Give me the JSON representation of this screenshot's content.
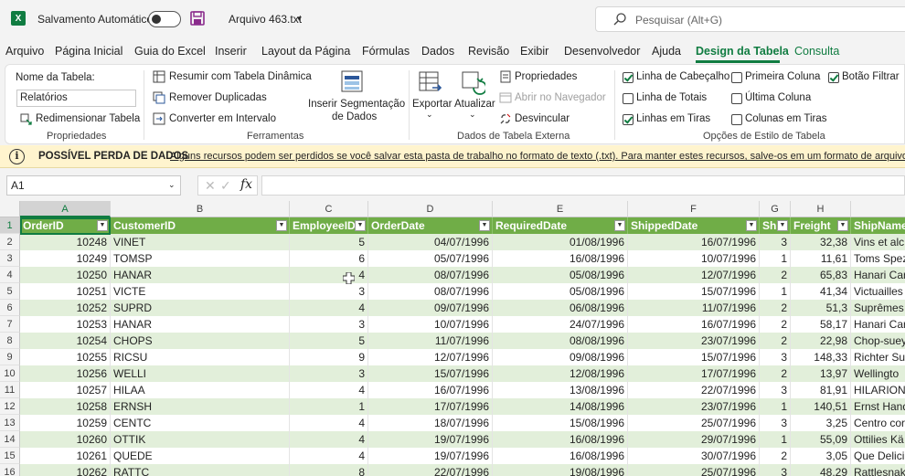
{
  "titlebar": {
    "autosave_label": "Salvamento Automático",
    "file_name": "Arquivo 463.txt",
    "search_placeholder": "Pesquisar (Alt+G)"
  },
  "menu": [
    "Arquivo",
    "Página Inicial",
    "Guia do Excel",
    "Inserir",
    "Layout da Página",
    "Fórmulas",
    "Dados",
    "Revisão",
    "Exibir",
    "Desenvolvedor",
    "Ajuda",
    "Design da Tabela",
    "Consulta"
  ],
  "ribbon": {
    "propriedades": {
      "label": "Propriedades",
      "table_name_label": "Nome da Tabela:",
      "table_name_value": "Relatórios",
      "resize": "Redimensionar Tabela"
    },
    "ferramentas": {
      "label": "Ferramentas",
      "pivot": "Resumir com Tabela Dinâmica",
      "dupes": "Remover Duplicadas",
      "convert": "Converter em Intervalo",
      "slicer_line1": "Inserir Segmentação",
      "slicer_line2": "de Dados"
    },
    "externa": {
      "label": "Dados de Tabela Externa",
      "export": "Exportar",
      "refresh": "Atualizar",
      "props": "Propriedades",
      "open_browser": "Abrir no Navegador",
      "unlink": "Desvincular"
    },
    "estilo": {
      "label": "Opções de Estilo de Tabela",
      "header_row": "Linha de Cabeçalho",
      "total_row": "Linha de Totais",
      "banded_rows": "Linhas em Tiras",
      "first_col": "Primeira Coluna",
      "last_col": "Última Coluna",
      "banded_cols": "Colunas em Tiras",
      "filter_btn": "Botão Filtrar"
    }
  },
  "infobar": {
    "title": "POSSÍVEL PERDA DE DADOS",
    "message": "Alguns recursos podem ser perdidos se você salvar esta pasta de trabalho no formato de texto (.txt). Para manter estes recursos, salve-os em um formato de arquivo do Excel"
  },
  "formula": {
    "name_box": "A1",
    "fx": "fx"
  },
  "grid": {
    "columns": [
      "A",
      "B",
      "C",
      "D",
      "E",
      "F",
      "G",
      "H"
    ],
    "headers": [
      "OrderID",
      "CustomerID",
      "EmployeeID",
      "OrderDate",
      "RequiredDate",
      "ShippedDate",
      "Sh",
      "Freight",
      "ShipName"
    ],
    "row_numbers": [
      "1",
      "2",
      "3",
      "4",
      "5",
      "6",
      "7",
      "8",
      "9",
      "10",
      "11",
      "12",
      "13",
      "14",
      "15",
      "16"
    ],
    "rows": [
      [
        "10248",
        "VINET",
        "5",
        "04/07/1996",
        "01/08/1996",
        "16/07/1996",
        "3",
        "32,38",
        "Vins et alc"
      ],
      [
        "10249",
        "TOMSP",
        "6",
        "05/07/1996",
        "16/08/1996",
        "10/07/1996",
        "1",
        "11,61",
        "Toms Spez"
      ],
      [
        "10250",
        "HANAR",
        "4",
        "08/07/1996",
        "05/08/1996",
        "12/07/1996",
        "2",
        "65,83",
        "Hanari Car"
      ],
      [
        "10251",
        "VICTE",
        "3",
        "08/07/1996",
        "05/08/1996",
        "15/07/1996",
        "1",
        "41,34",
        "Victuailles"
      ],
      [
        "10252",
        "SUPRD",
        "4",
        "09/07/1996",
        "06/08/1996",
        "11/07/1996",
        "2",
        "51,3",
        "Suprêmes"
      ],
      [
        "10253",
        "HANAR",
        "3",
        "10/07/1996",
        "24/07/1996",
        "16/07/1996",
        "2",
        "58,17",
        "Hanari Car"
      ],
      [
        "10254",
        "CHOPS",
        "5",
        "11/07/1996",
        "08/08/1996",
        "23/07/1996",
        "2",
        "22,98",
        "Chop-suey"
      ],
      [
        "10255",
        "RICSU",
        "9",
        "12/07/1996",
        "09/08/1996",
        "15/07/1996",
        "3",
        "148,33",
        "Richter Su"
      ],
      [
        "10256",
        "WELLI",
        "3",
        "15/07/1996",
        "12/08/1996",
        "17/07/1996",
        "2",
        "13,97",
        "Wellingto"
      ],
      [
        "10257",
        "HILAA",
        "4",
        "16/07/1996",
        "13/08/1996",
        "22/07/1996",
        "3",
        "81,91",
        "HILARION-"
      ],
      [
        "10258",
        "ERNSH",
        "1",
        "17/07/1996",
        "14/08/1996",
        "23/07/1996",
        "1",
        "140,51",
        "Ernst Hand"
      ],
      [
        "10259",
        "CENTC",
        "4",
        "18/07/1996",
        "15/08/1996",
        "25/07/1996",
        "3",
        "3,25",
        "Centro cor"
      ],
      [
        "10260",
        "OTTIK",
        "4",
        "19/07/1996",
        "16/08/1996",
        "29/07/1996",
        "1",
        "55,09",
        "Ottilies Kä"
      ],
      [
        "10261",
        "QUEDE",
        "4",
        "19/07/1996",
        "16/08/1996",
        "30/07/1996",
        "2",
        "3,05",
        "Que Delici"
      ],
      [
        "10262",
        "RATTC",
        "8",
        "22/07/1996",
        "19/08/1996",
        "25/07/1996",
        "3",
        "48,29",
        "Rattlesnak"
      ]
    ]
  }
}
